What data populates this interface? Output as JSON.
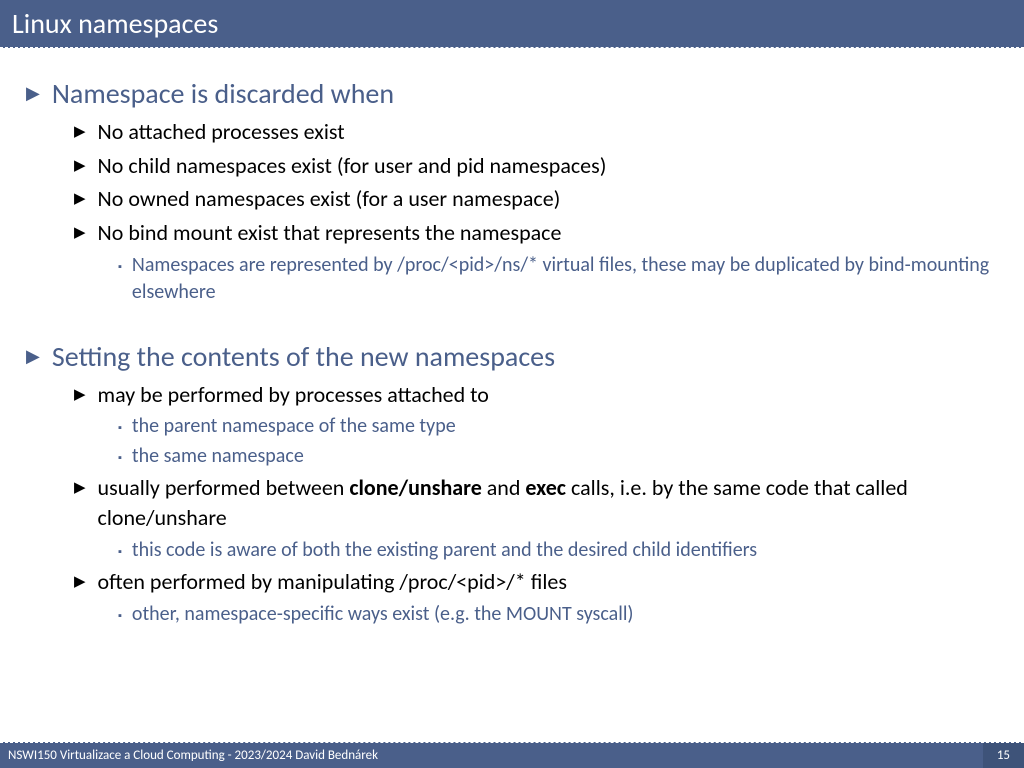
{
  "title": "Linux namespaces",
  "footer": {
    "left": "NSWI150 Virtualizace a Cloud Computing - 2023/2024 David Bednárek",
    "page": "15"
  },
  "s1_h": "Namespace is discarded when",
  "s1_i1": "No attached processes exist",
  "s1_i2": "No child namespaces exist (for user and pid namespaces)",
  "s1_i3": "No owned namespaces exist (for a user namespace)",
  "s1_i4": "No bind mount exist that represents the namespace",
  "s1_i4_a": "Namespaces are represented by /proc/<pid>/ns/* virtual files, these may be duplicated by bind-mounting elsewhere",
  "s2_h": "Setting the contents of the new namespaces",
  "s2_i1": "may be performed by processes attached to",
  "s2_i1_a": "the parent namespace of the same type",
  "s2_i1_b": "the same namespace",
  "s2_i2_pre": "usually performed between ",
  "s2_i2_b1": "clone/unshare",
  "s2_i2_mid": " and ",
  "s2_i2_b2": "exec",
  "s2_i2_post": " calls, i.e. by the same code that called clone/unshare",
  "s2_i2_a": "this code is aware of both the existing parent and the desired child identifiers",
  "s2_i3": "often performed by manipulating /proc/<pid>/* files",
  "s2_i3_a": "other, namespace-specific ways exist (e.g. the MOUNT syscall)"
}
